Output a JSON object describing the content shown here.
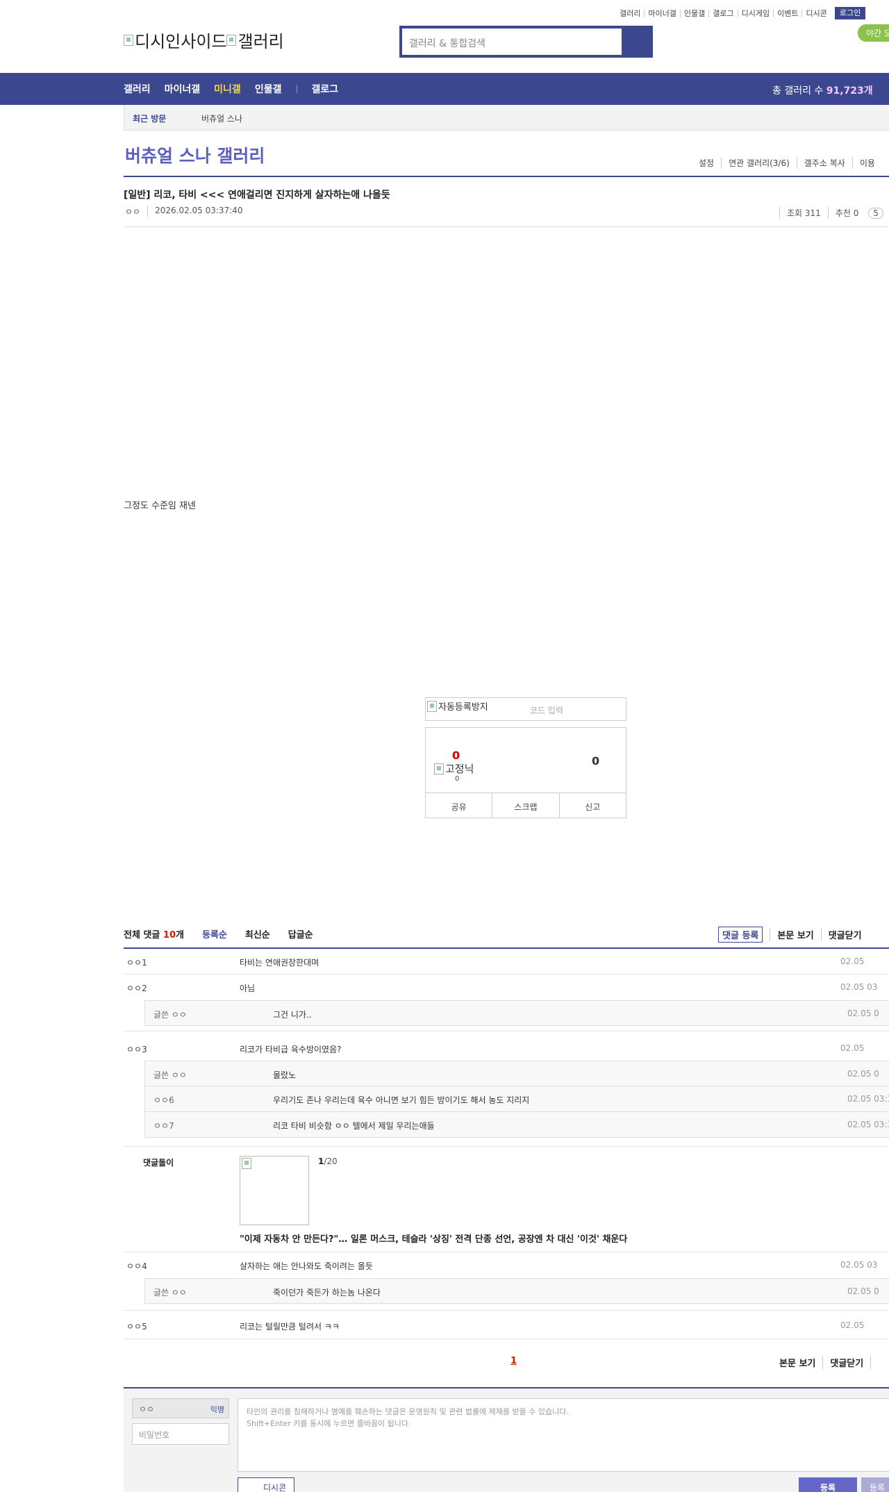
{
  "top_links": [
    "갤러리",
    "마이너갤",
    "인물갤",
    "갤로그",
    "디시게임",
    "이벤트",
    "디시콘"
  ],
  "login_label": "로그인",
  "night_mode_label": "야간 모드",
  "logo": {
    "alt_main": "디시인사이드",
    "alt_sub": "갤러리"
  },
  "search": {
    "placeholder": "갤러리 & 통합검색"
  },
  "nav": {
    "items": [
      "갤러리",
      "마이너갤",
      "미니갤",
      "인물갤"
    ],
    "extra": "갤로그",
    "total_label": "총 갤러리 수",
    "total_value": "91,723개"
  },
  "recent": {
    "title": "최근 방문",
    "item": "버츄얼 스나"
  },
  "gallery": {
    "title": "버츄얼 스나 갤러리",
    "menu": [
      "설정",
      "연관 갤러리(3/6)",
      "갤주소 복사",
      "이용"
    ]
  },
  "post": {
    "title": "[일반] 리코, 타비 <<< 연애걸리면 진지하게 살자하는애 나올듯",
    "author": "ㅇㅇ",
    "date": "2026.02.05 03:37:40",
    "views_label": "조회 311",
    "reco_label": "추천 0",
    "comments_badge": "5",
    "body": "그정도 수준임 재넨"
  },
  "captcha": {
    "img_alt": "자동등록방지",
    "placeholder": "코드 입력"
  },
  "recommend": {
    "up": "0",
    "fixed_alt": "고정닉",
    "fixed_count": "0",
    "down": "0",
    "buttons": [
      "공유",
      "스크랩",
      "신고"
    ]
  },
  "comments_header": {
    "total_label": "전체 댓글",
    "total_count": "10",
    "total_unit": "개",
    "sorts": [
      "등록순",
      "최신순",
      "답글순"
    ],
    "tools": [
      "댓글 등록",
      "본문 보기",
      "댓글닫기"
    ]
  },
  "comments": [
    {
      "nick": "ㅇㅇ1",
      "text": "타비는 연애권장한대며",
      "date": "02.05"
    },
    {
      "nick": "ㅇㅇ2",
      "text": "아님",
      "date": "02.05 03"
    },
    {
      "nick": "ㅇㅇ3",
      "text": "리코가 타비급 육수방이였음?",
      "date": "02.05"
    },
    {
      "nick": "ㅇㅇ4",
      "text": "살자하는 애는 안나와도 죽이려는 올듯",
      "date": "02.05 03"
    },
    {
      "nick": "ㅇㅇ5",
      "text": "리코는 털릴만큼 털려서 ㅋㅋ",
      "date": "02.05"
    }
  ],
  "replies": [
    {
      "nick": "글쓴 ㅇㅇ",
      "text": "그건 니가..",
      "date": "02.05 0"
    },
    {
      "nick": "글쓴 ㅇㅇ",
      "text": "몰랐노",
      "date": "02.05 0"
    },
    {
      "nick": "ㅇㅇ6",
      "text": "우리기도 존나 우리는데 육수 아니면 보기 힘든 방이기도 해서 농도 지리지",
      "date": "02.05 03:3"
    },
    {
      "nick": "ㅇㅇ7",
      "text": "리코 타비 비슷함 ㅇㅇ 텔에서 제일 우리는애들",
      "date": "02.05 03:3"
    },
    {
      "nick": "글쓴 ㅇㅇ",
      "text": "죽이던가 죽든가 하는놈 나온다",
      "date": "02.05 0"
    }
  ],
  "dolls": {
    "label": "댓글돌이",
    "page_current": "1",
    "page_total": "/20",
    "headline": "\"이제 자동차 안 만든다?\"… 일론 머스크, 테슬라 '상징' 전격 단종 선언, 공장엔 차 대신 '이것' 채운다"
  },
  "pager": {
    "current": "1",
    "tools": [
      "본문 보기",
      "댓글닫기"
    ]
  },
  "write": {
    "name_value": "ㅇㅇ",
    "anon_label": "익명",
    "password_placeholder": "비밀번호",
    "notice_line1": "타인의 권리를 침해하거나 명예를 훼손하는 댓글은 운영원칙 및 관련 법률에 제재를 받을 수 있습니다.",
    "notice_line2": "Shift+Enter 키를 동시에 누르면 줄바꿈이 됩니다.",
    "dccon_label": "디시콘",
    "submit_label": "등록",
    "submit2_label": "등록"
  }
}
